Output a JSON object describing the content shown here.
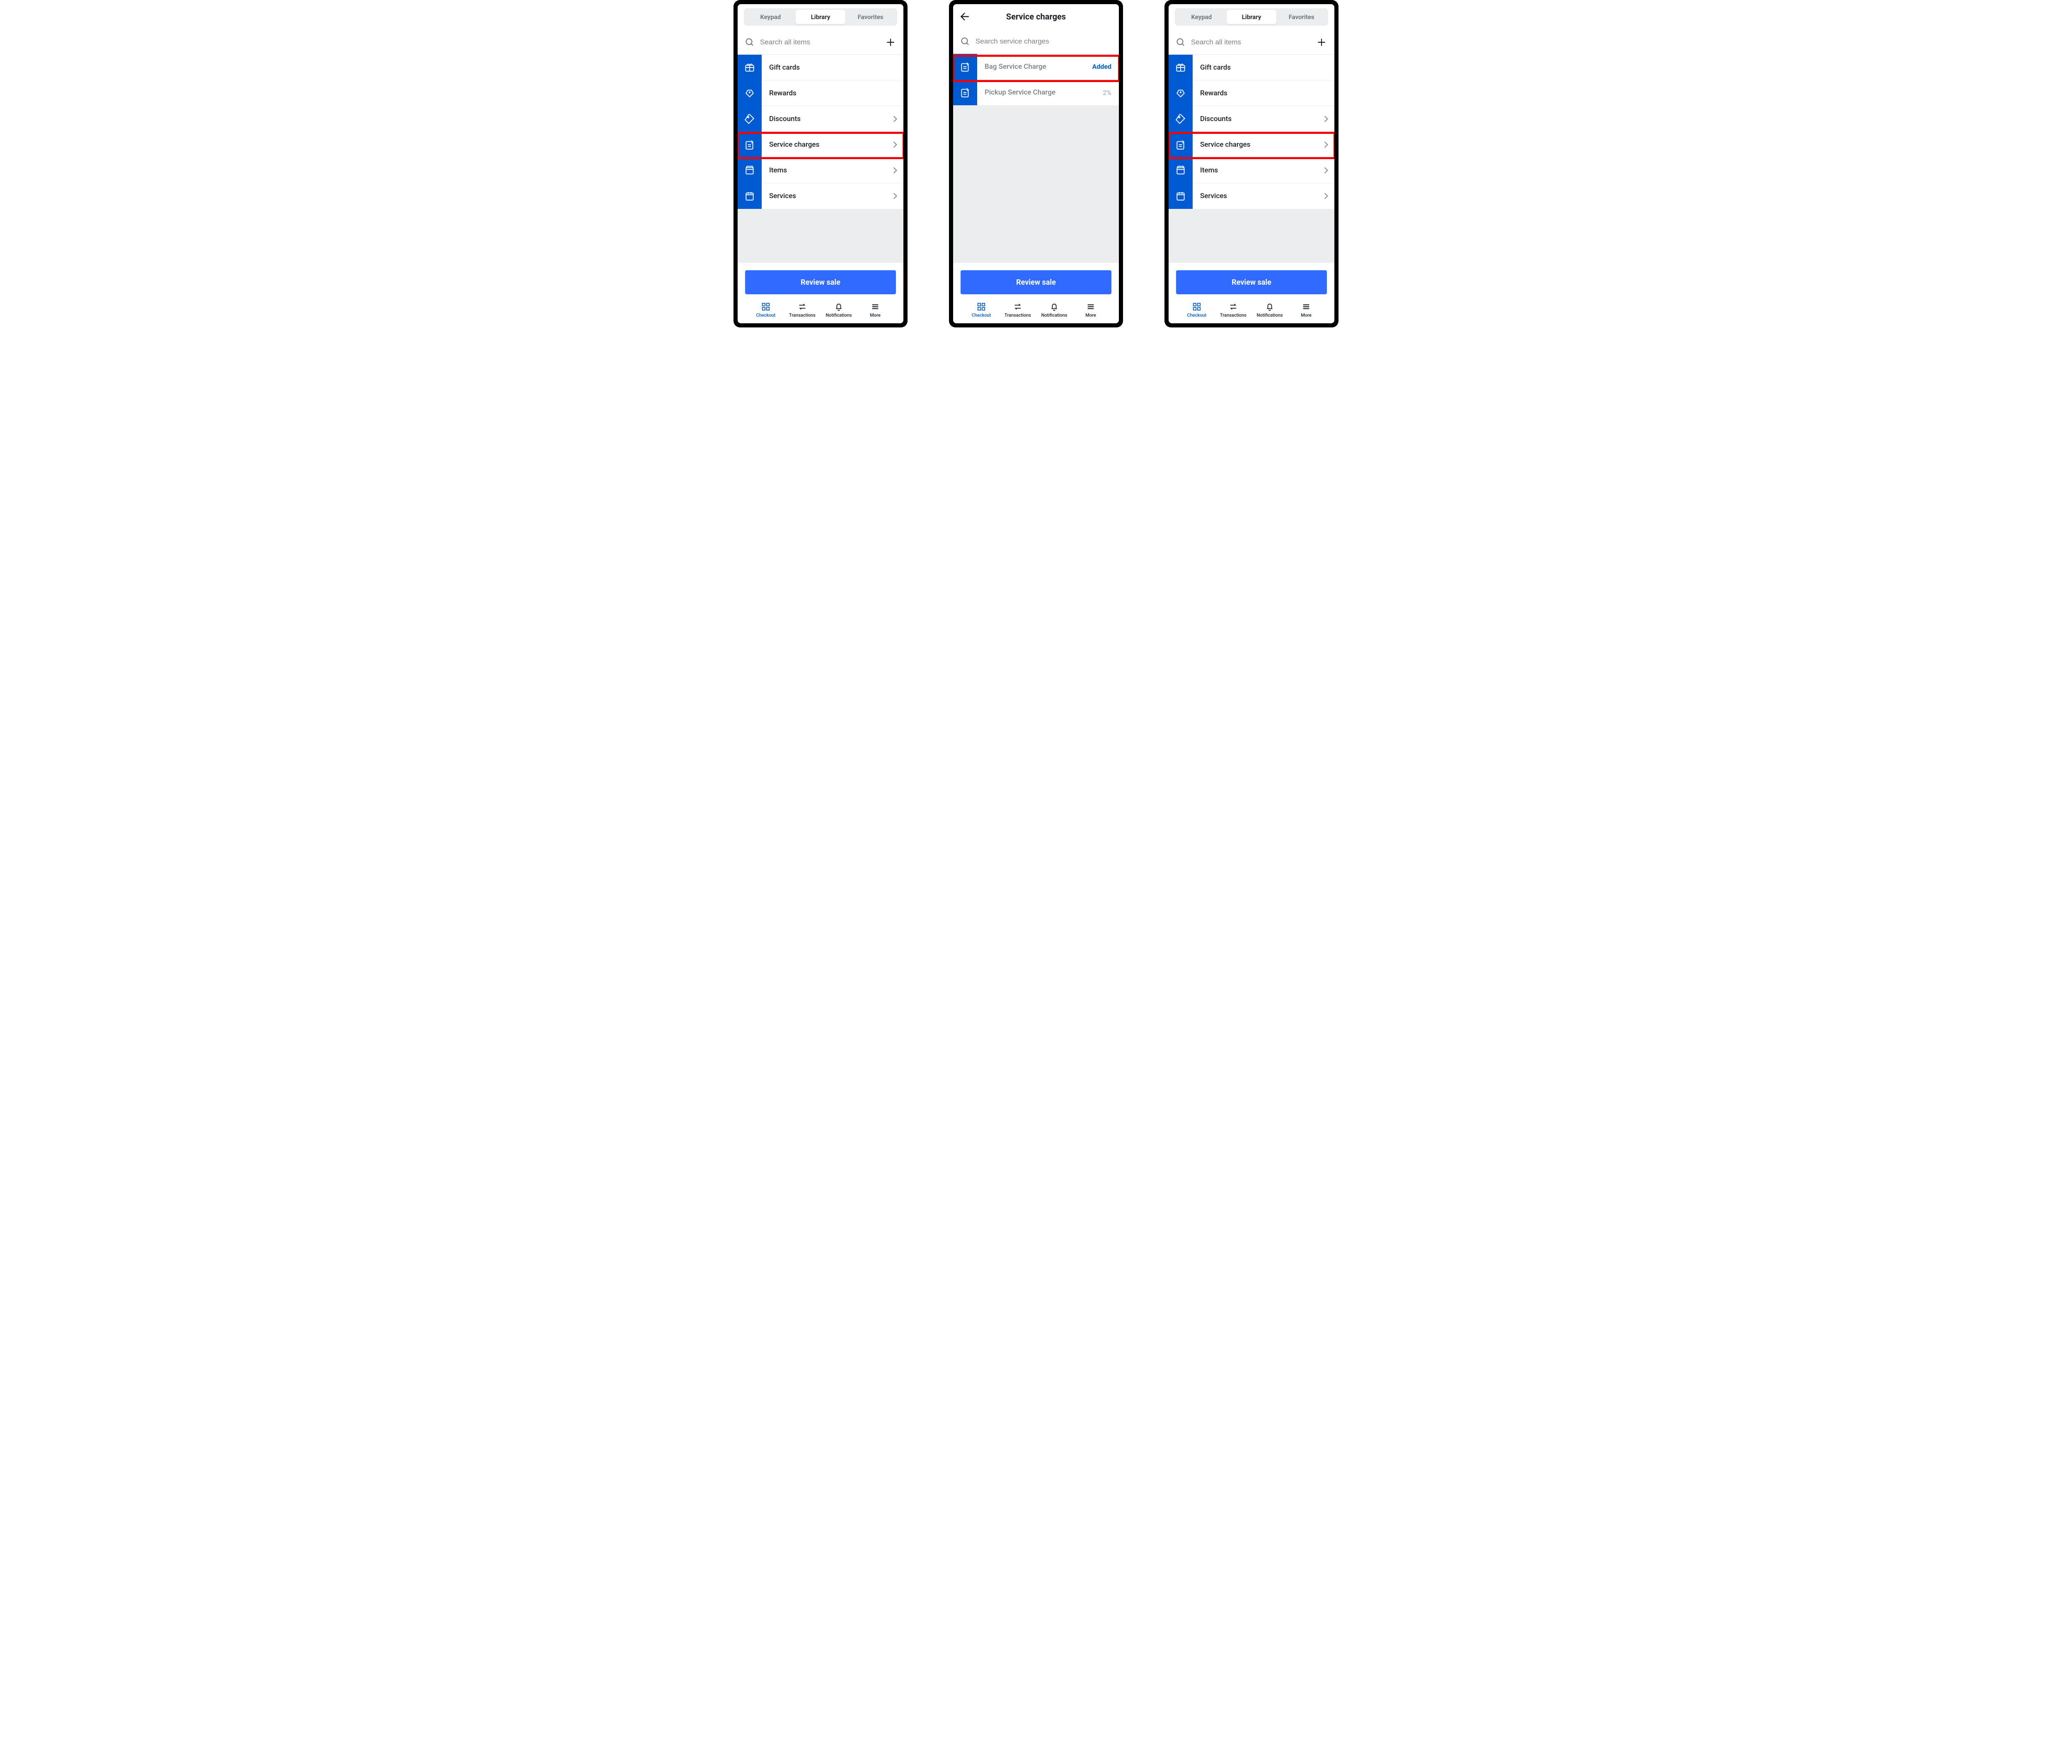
{
  "tabs_segmented": {
    "keypad": "Keypad",
    "library": "Library",
    "favorites": "Favorites"
  },
  "search_all_placeholder": "Search all items",
  "search_charges_placeholder": "Search service charges",
  "library_items": [
    {
      "label": "Gift cards",
      "chevron": false
    },
    {
      "label": "Rewards",
      "chevron": false
    },
    {
      "label": "Discounts",
      "chevron": true
    },
    {
      "label": "Service charges",
      "chevron": true
    },
    {
      "label": "Items",
      "chevron": true
    },
    {
      "label": "Services",
      "chevron": true
    }
  ],
  "service_charges_title": "Service charges",
  "charges": [
    {
      "name": "Bag Service Charge",
      "status": "Added"
    },
    {
      "name": "Pickup Service Charge",
      "status": "2%"
    }
  ],
  "review_label": "Review sale",
  "tabbar": {
    "checkout": "Checkout",
    "transactions": "Transactions",
    "notifications": "Notifications",
    "more": "More"
  }
}
